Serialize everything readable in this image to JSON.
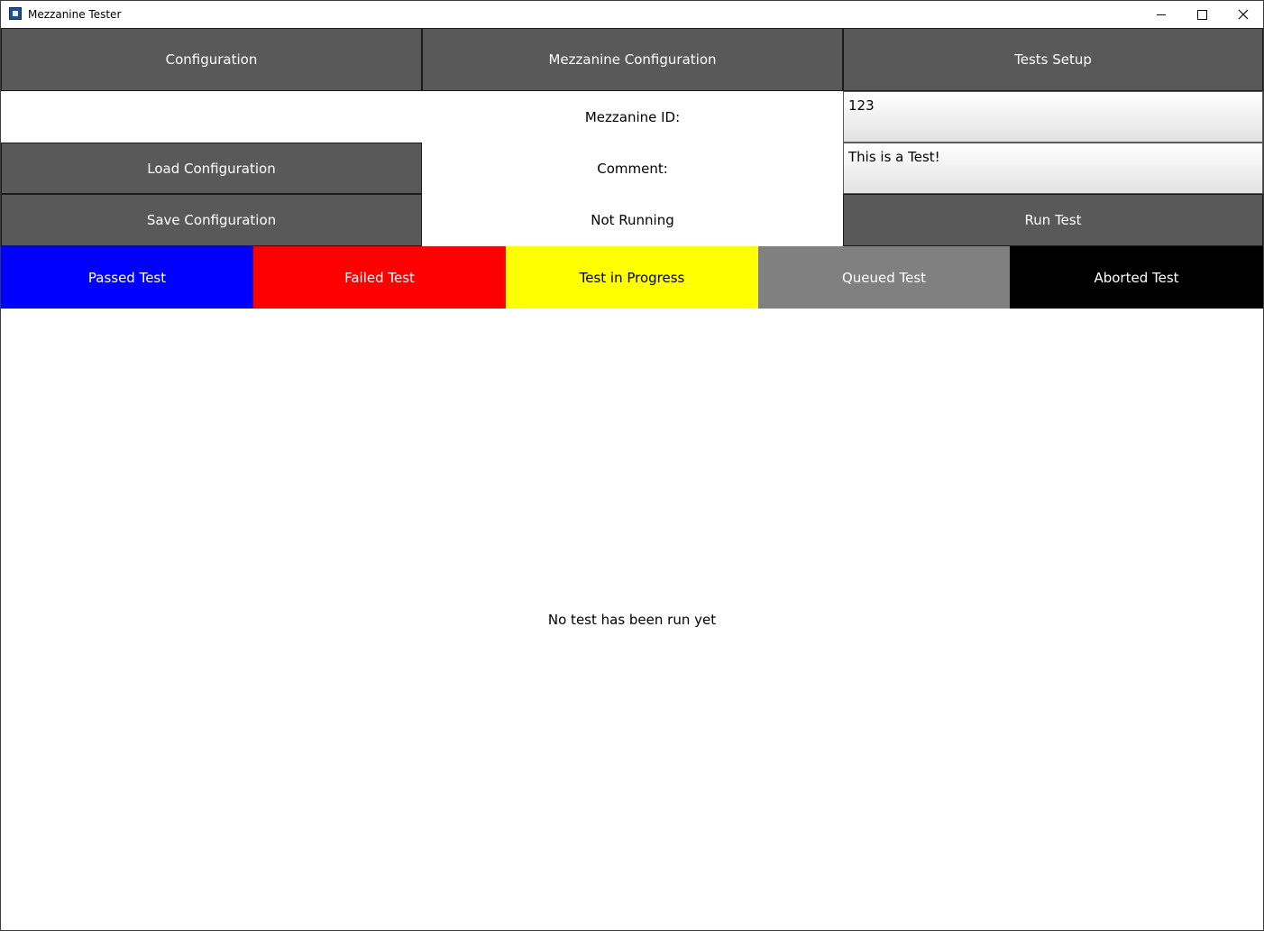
{
  "window": {
    "title": "Mezzanine Tester",
    "icon": "app-icon",
    "controls": [
      "minimize-icon",
      "maximize-icon",
      "close-icon"
    ]
  },
  "nav": {
    "configuration": "Configuration",
    "mezzanine_configuration": "Mezzanine Configuration",
    "tests_setup": "Tests Setup"
  },
  "form": {
    "mezzanine_id_label": "Mezzanine ID:",
    "mezzanine_id_value": "123",
    "comment_label": "Comment:",
    "comment_value": "This is a Test!",
    "status": "Not Running"
  },
  "actions": {
    "load_configuration": "Load Configuration",
    "save_configuration": "Save Configuration",
    "run_test": "Run Test"
  },
  "legend": [
    {
      "label": "Passed Test",
      "color": "#0000ff",
      "text_color": "#ffffff"
    },
    {
      "label": "Failed Test",
      "color": "#ff0000",
      "text_color": "#ffffff"
    },
    {
      "label": "Test in Progress",
      "color": "#ffff00",
      "text_color": "#000000"
    },
    {
      "label": "Queued Test",
      "color": "#808080",
      "text_color": "#ffffff"
    },
    {
      "label": "Aborted Test",
      "color": "#000000",
      "text_color": "#ffffff"
    }
  ],
  "results": {
    "empty_message": "No test has been run yet"
  },
  "colors": {
    "button_bg": "#595959",
    "button_text": "#ffffff"
  }
}
